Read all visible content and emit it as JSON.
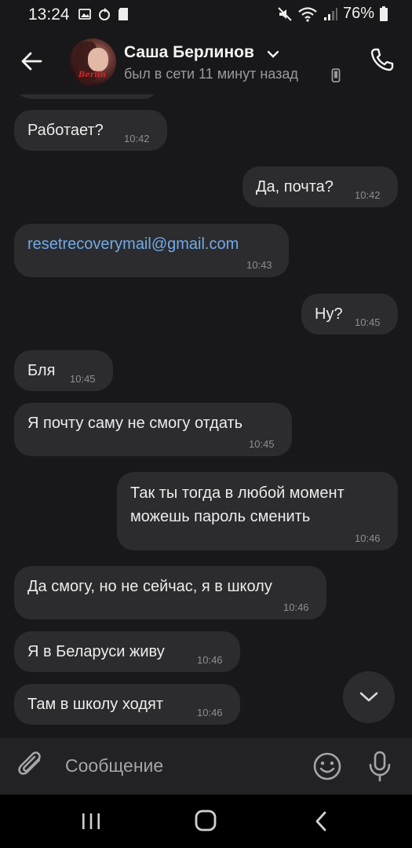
{
  "status_bar": {
    "time": "13:24",
    "battery_percent": "76%"
  },
  "header": {
    "contact_name": "Саша Берлинов",
    "last_seen": "был в сети 11 минут назад",
    "avatar_label": "Berlin"
  },
  "messages": [
    {
      "side": "in",
      "text": "Работает?",
      "time": "10:42"
    },
    {
      "side": "out",
      "text": "Да, почта?",
      "time": "10:42"
    },
    {
      "side": "in",
      "text": "resetrecoverymail@gmail.com",
      "time": "10:43",
      "is_link": true
    },
    {
      "side": "out",
      "text": "Ну?",
      "time": "10:45"
    },
    {
      "side": "in",
      "text": "Бля",
      "time": "10:45"
    },
    {
      "side": "in",
      "text": "Я почту саму не смогу отдать",
      "time": "10:45"
    },
    {
      "side": "out",
      "line1": "Так ты тогда в любой момент",
      "line2": "можешь пароль сменить",
      "time": "10:46"
    },
    {
      "side": "in",
      "text": "Да смогу, но не сейчас, я в школу",
      "time": "10:46"
    },
    {
      "side": "in",
      "text": "Я в Беларуси живу",
      "time": "10:46"
    },
    {
      "side": "in",
      "text": "Там в школу ходят",
      "time": "10:46"
    }
  ],
  "composer": {
    "placeholder": "Сообщение"
  },
  "colors": {
    "background": "#18181a",
    "bubble": "#2c2c2e",
    "link": "#71aaeb",
    "timestamp": "#8e8e92"
  },
  "icons": [
    "back-arrow-icon",
    "chevron-down-icon",
    "phone-icon",
    "phone-device-icon",
    "paperclip-icon",
    "smile-icon",
    "microphone-icon",
    "scroll-down-icon",
    "recent-apps-icon",
    "home-icon",
    "nav-back-icon"
  ]
}
